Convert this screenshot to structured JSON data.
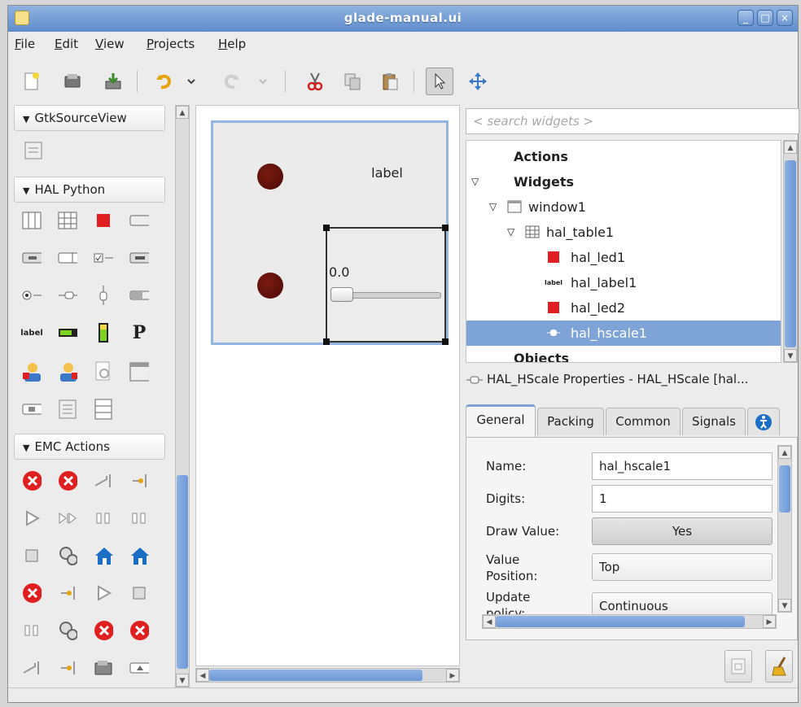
{
  "window": {
    "title": "glade-manual.ui"
  },
  "menu": [
    "File",
    "Edit",
    "View",
    "Projects",
    "Help"
  ],
  "palette": {
    "groups": [
      "GtkSourceView",
      "HAL Python",
      "EMC Actions"
    ],
    "small_label_icon": "label"
  },
  "canvas": {
    "label_widget_text": "label",
    "hscale_value": "0.0"
  },
  "search": {
    "placeholder": "< search widgets >"
  },
  "tree": {
    "items": [
      {
        "label": "Actions",
        "bold": true,
        "icon": "none"
      },
      {
        "label": "Widgets",
        "bold": true,
        "icon": "none"
      },
      {
        "label": "window1",
        "bold": false,
        "icon": "window-icon"
      },
      {
        "label": "hal_table1",
        "bold": false,
        "icon": "table-icon"
      },
      {
        "label": "hal_led1",
        "bold": false,
        "icon": "led-icon"
      },
      {
        "label": "hal_label1",
        "bold": false,
        "icon": "label-icon"
      },
      {
        "label": "hal_led2",
        "bold": false,
        "icon": "led-icon"
      },
      {
        "label": "hal_hscale1",
        "bold": false,
        "icon": "hscale-icon"
      },
      {
        "label": "Objects",
        "bold": true,
        "icon": "none"
      }
    ],
    "selected": "hal_hscale1"
  },
  "properties": {
    "title": "HAL_HScale Properties - HAL_HScale [hal...",
    "tabs": [
      "General",
      "Packing",
      "Common",
      "Signals"
    ],
    "active_tab": "General",
    "rows": {
      "name_label": "Name:",
      "name_value": "hal_hscale1",
      "digits_label": "Digits:",
      "digits_value": "1",
      "draw_value_label": "Draw Value:",
      "draw_value_value": "Yes",
      "value_position_label_1": "Value",
      "value_position_label_2": "Position:",
      "value_position_value": "Top",
      "update_policy_label_1": "Update",
      "update_policy_label_2": "policy:",
      "update_policy_value": "Continuous"
    }
  },
  "colors": {
    "accent": "#7ea3d6",
    "led": "#5a0e07",
    "red_icon": "#e02020"
  }
}
